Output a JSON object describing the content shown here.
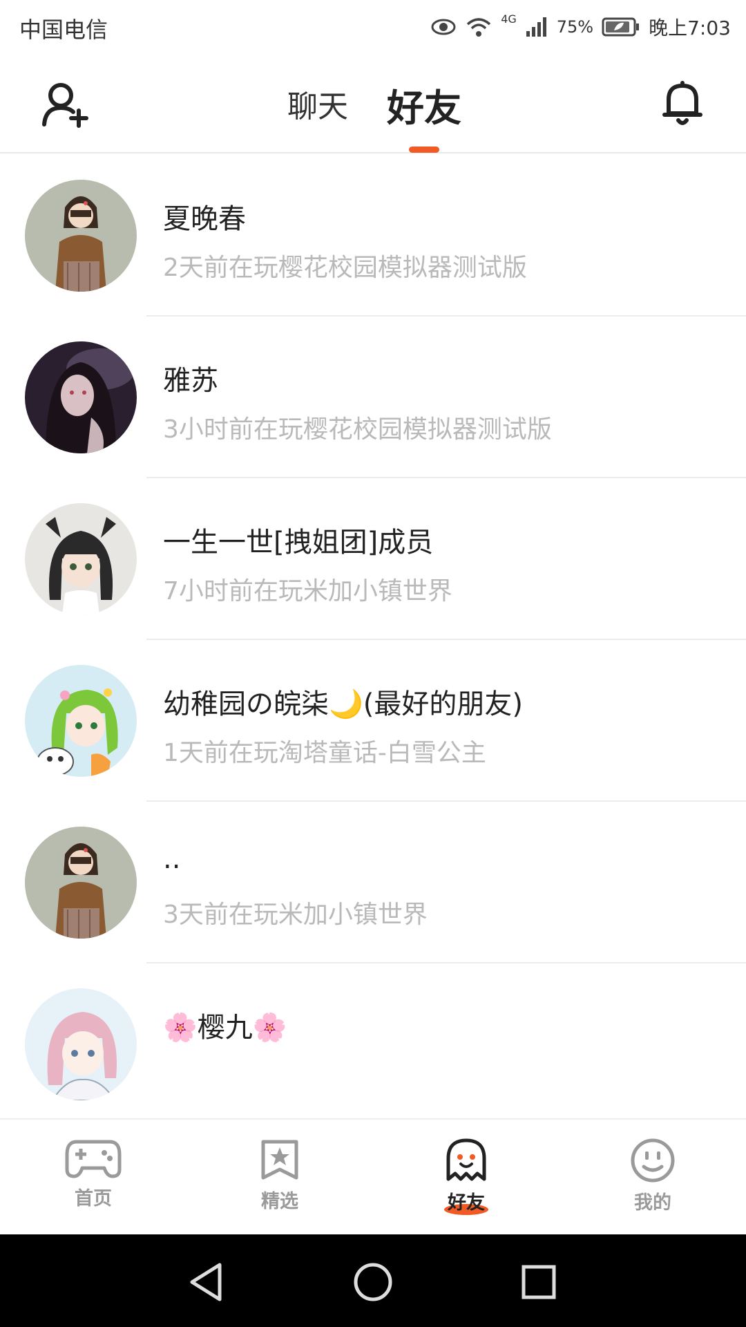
{
  "status_bar": {
    "carrier": "中国电信",
    "network": "4G",
    "battery": "75%",
    "time": "晚上7:03",
    "icons": [
      "eye-icon",
      "wifi-icon",
      "signal-icon",
      "battery-icon"
    ]
  },
  "header": {
    "tabs": [
      {
        "label": "聊天",
        "active": false
      },
      {
        "label": "好友",
        "active": true
      }
    ],
    "left_icon": "add-friend-icon",
    "right_icon": "bell-icon",
    "accent_color": "#f15a24"
  },
  "friends": [
    {
      "name": "夏晚春",
      "status": "2天前在玩樱花校园模拟器测试版",
      "avatar": "avatar-girl-brown-hair"
    },
    {
      "name": "雅苏",
      "status": "3小时前在玩樱花校园模拟器测试版",
      "avatar": "avatar-anime-dark"
    },
    {
      "name": "一生一世[拽姐团]成员",
      "status": "7小时前在玩米加小镇世界",
      "avatar": "avatar-anime-cat-ears"
    },
    {
      "name": "幼稚园の皖柒🌙(最好的朋友)",
      "status": "1天前在玩淘塔童话-白雪公主",
      "avatar": "avatar-anime-green-hair"
    },
    {
      "name": "..",
      "status": "3天前在玩米加小镇世界",
      "avatar": "avatar-girl-brown-hair"
    },
    {
      "name": "🌸樱九🌸",
      "status": "",
      "avatar": "avatar-anime-pink-hair"
    }
  ],
  "bottom_nav": [
    {
      "label": "首页",
      "icon": "gamepad-icon",
      "active": false
    },
    {
      "label": "精选",
      "icon": "star-bookmark-icon",
      "active": false
    },
    {
      "label": "好友",
      "icon": "ghost-icon",
      "active": true
    },
    {
      "label": "我的",
      "icon": "smiley-icon",
      "active": false
    }
  ],
  "system_nav": [
    "back-icon",
    "home-icon",
    "recents-icon"
  ]
}
